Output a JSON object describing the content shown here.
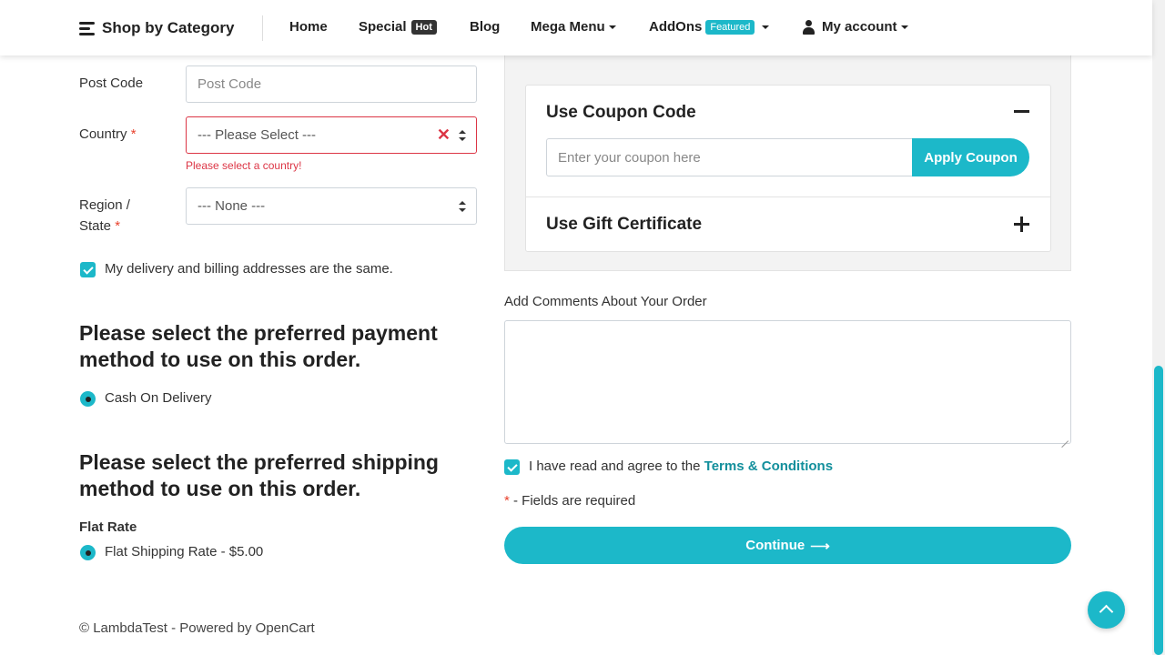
{
  "header": {
    "category_label": "Shop by Category",
    "nav": {
      "home": "Home",
      "special": "Special",
      "special_badge": "Hot",
      "blog": "Blog",
      "mega_menu": "Mega Menu",
      "addons": "AddOns",
      "addons_badge": "Featured",
      "account": "My account"
    }
  },
  "address_form": {
    "post_code": {
      "label": "Post Code",
      "placeholder": "Post Code",
      "value": ""
    },
    "country": {
      "label": "Country",
      "required_mark": "*",
      "selected": "--- Please Select ---",
      "error": "Please select a country!"
    },
    "region": {
      "label_line1": "Region /",
      "label_line2": "State",
      "required_mark": "*",
      "selected": "--- None ---"
    },
    "same_address": {
      "label": "My delivery and billing addresses are the same.",
      "checked": true
    }
  },
  "payment": {
    "heading_line1": "Please select the preferred payment",
    "heading_line2": "method to use on this order.",
    "option": "Cash On Delivery",
    "selected": true
  },
  "shipping": {
    "heading_line1": "Please select the preferred shipping",
    "heading_line2": "method to use on this order.",
    "group": "Flat Rate",
    "option": "Flat Shipping Rate - $5.00",
    "selected": true
  },
  "coupon": {
    "title": "Use Coupon Code",
    "placeholder": "Enter your coupon here",
    "button": "Apply Coupon",
    "expanded": true
  },
  "gift": {
    "title": "Use Gift Certificate",
    "expanded": false
  },
  "comments": {
    "label": "Add Comments About Your Order",
    "value": ""
  },
  "terms": {
    "prefix": "I have read and agree to the",
    "link": "Terms & Conditions",
    "checked": true
  },
  "required_note": {
    "mark": "*",
    "text": "- Fields are required"
  },
  "continue_button": "Continue",
  "footer": "© LambdaTest - Powered by OpenCart",
  "colors": {
    "accent": "#1cb8c9",
    "error": "#dc3545",
    "link": "#138f9c"
  },
  "icons": [
    "menu-icon",
    "user-icon",
    "chevron-down-icon",
    "clear-icon",
    "select-arrows-icon",
    "check-icon",
    "radio-icon",
    "minus-icon",
    "plus-icon",
    "arrow-right-icon",
    "arrow-up-icon"
  ]
}
